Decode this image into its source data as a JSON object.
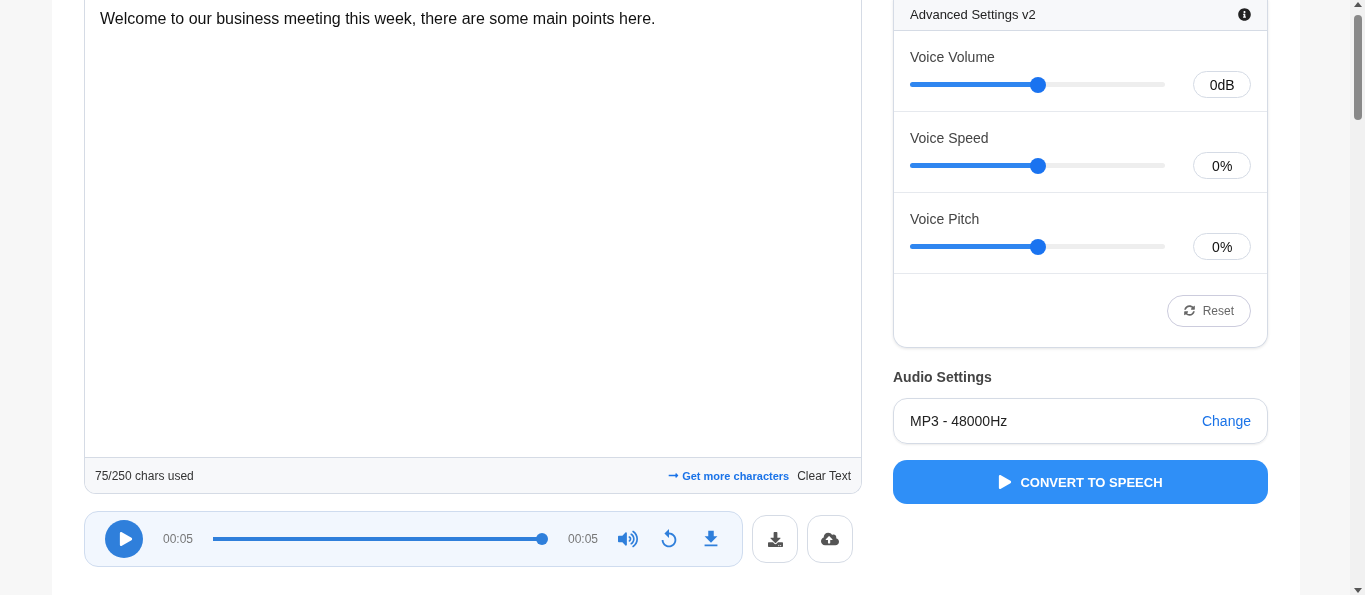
{
  "editor": {
    "text": "Welcome to our business meeting this week, there are some main points here.",
    "usage": "75/250 chars used",
    "more_link": "Get more characters",
    "clear_button": "Clear Text"
  },
  "player": {
    "elapsed": "00:05",
    "duration": "00:05",
    "level": 1
  },
  "advanced": {
    "title": "Advanced Settings v2",
    "sliders": [
      {
        "label": "Voice Volume",
        "level": 0.5,
        "value": "0dB"
      },
      {
        "label": "Voice Speed",
        "level": 0.5,
        "value": "0%"
      },
      {
        "label": "Voice Pitch",
        "level": 0.5,
        "value": "0%"
      }
    ],
    "reset_button": "Reset"
  },
  "audio": {
    "heading": "Audio Settings",
    "format": "MP3 - 48000Hz",
    "change_link": "Change"
  },
  "convert_button": "CONVERT TO SPEECH"
}
